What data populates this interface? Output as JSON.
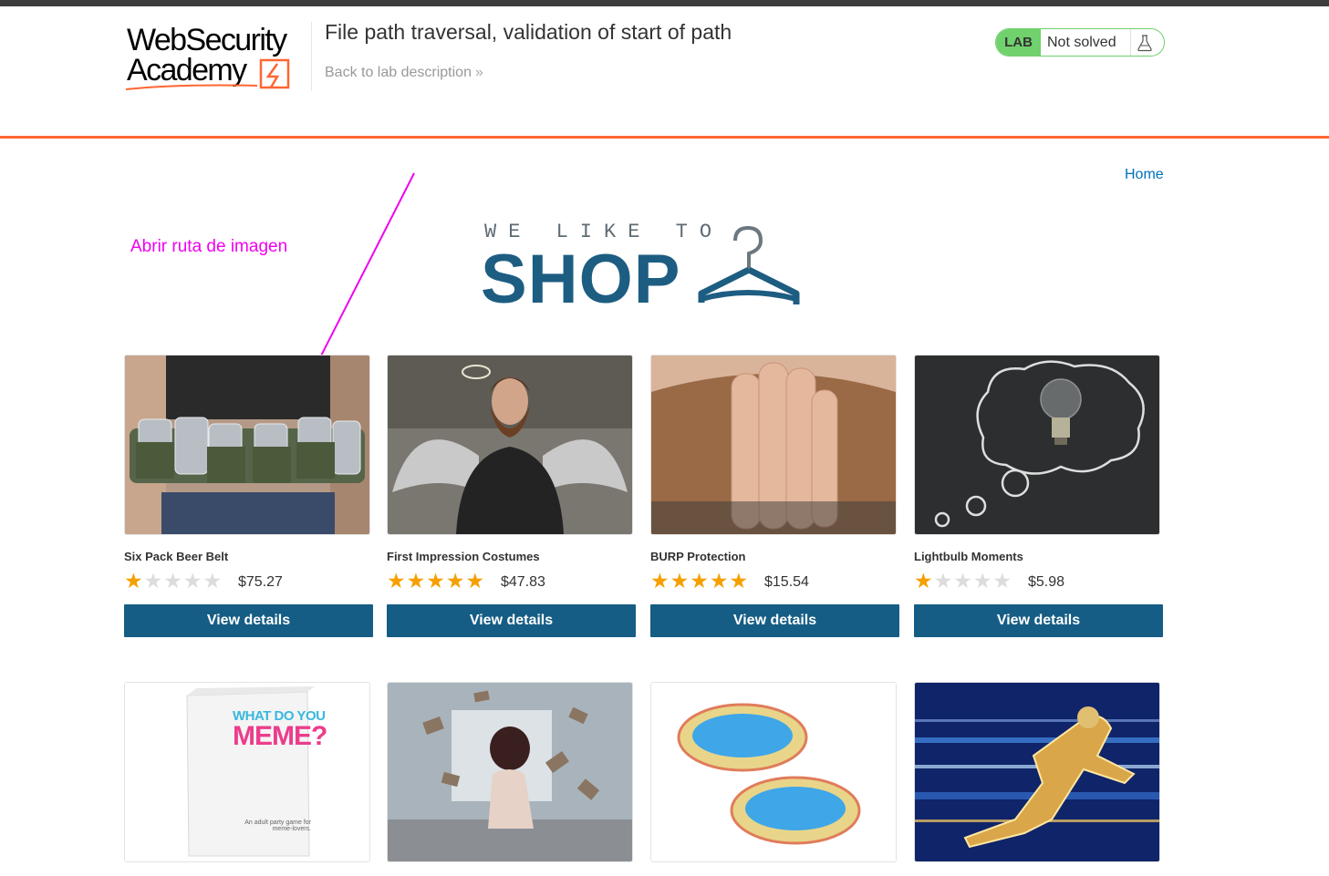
{
  "header": {
    "logo_line1": "WebSecurity",
    "logo_line2": "Academy",
    "lab_title": "File path traversal, validation of start of path",
    "back_link": "Back to lab description",
    "back_chevron": "»",
    "lab_badge": "LAB",
    "lab_status": "Not solved"
  },
  "nav": {
    "home": "Home"
  },
  "annotation": {
    "text": "Abrir ruta de imagen"
  },
  "shop_logo": {
    "tagline": "WE LIKE TO",
    "word": "SHOP"
  },
  "colors": {
    "accent": "#ff6633",
    "button": "#155d84",
    "lab_green": "#70d16d",
    "annotation": "#f000f0",
    "star": "#f5a000"
  },
  "products": [
    {
      "name": "Six Pack Beer Belt",
      "rating": 1,
      "price": "$75.27",
      "button": "View details",
      "image": "beer-belt"
    },
    {
      "name": "First Impression Costumes",
      "rating": 5,
      "price": "$47.83",
      "button": "View details",
      "image": "angel-man"
    },
    {
      "name": "BURP Protection",
      "rating": 5,
      "price": "$15.54",
      "button": "View details",
      "image": "beard-hand"
    },
    {
      "name": "Lightbulb Moments",
      "rating": 1,
      "price": "$5.98",
      "button": "View details",
      "image": "lightbulb-chalkboard"
    },
    {
      "name": "",
      "rating": 0,
      "price": "",
      "button": "",
      "image": "meme-card-game"
    },
    {
      "name": "",
      "rating": 0,
      "price": "",
      "button": "",
      "image": "flying-books"
    },
    {
      "name": "",
      "rating": 0,
      "price": "",
      "button": "",
      "image": "paddling-pools"
    },
    {
      "name": "",
      "rating": 0,
      "price": "",
      "button": "",
      "image": "speed-runner"
    }
  ],
  "product_images": {
    "meme_line1": "WHAT DO YOU",
    "meme_line2": "MEME?",
    "meme_small": "An adult party game for meme-lovers."
  }
}
